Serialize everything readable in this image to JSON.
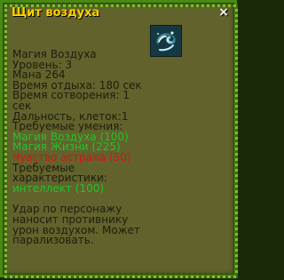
{
  "title": "Щит воздуха",
  "close_label": "×",
  "icon_name": "air-shield-spell-icon",
  "lines": {
    "school": "Магия Воздуха",
    "level": "Уровень: 3",
    "mana": "Мана 264",
    "rest_time": "Время отдыха: 180 сек",
    "cast_time_1": "Время сотворения: 1",
    "cast_time_2": "сек",
    "range": "Дальность, клеток:1",
    "req_skills_header": "Требуемые умения:",
    "req_skill_1": "Магия Воздуха (100)",
    "req_skill_2": "Магия Жизни (225)",
    "req_skill_3": "Чувство астрала (50)",
    "req_stats_header_1": "Требуемые",
    "req_stats_header_2": "характеристики:",
    "req_stat_1": "интеллект (100)",
    "desc_1": "Удар по персонажу",
    "desc_2": "наносит противнику",
    "desc_3": "урон воздухом. Может",
    "desc_4": "парализовать."
  },
  "colors": {
    "panel_bg": "#62622d",
    "title": "#ffd200",
    "met_requirement": "#22c32a",
    "unmet_requirement": "#d41414",
    "text": "#1e1e0c"
  }
}
